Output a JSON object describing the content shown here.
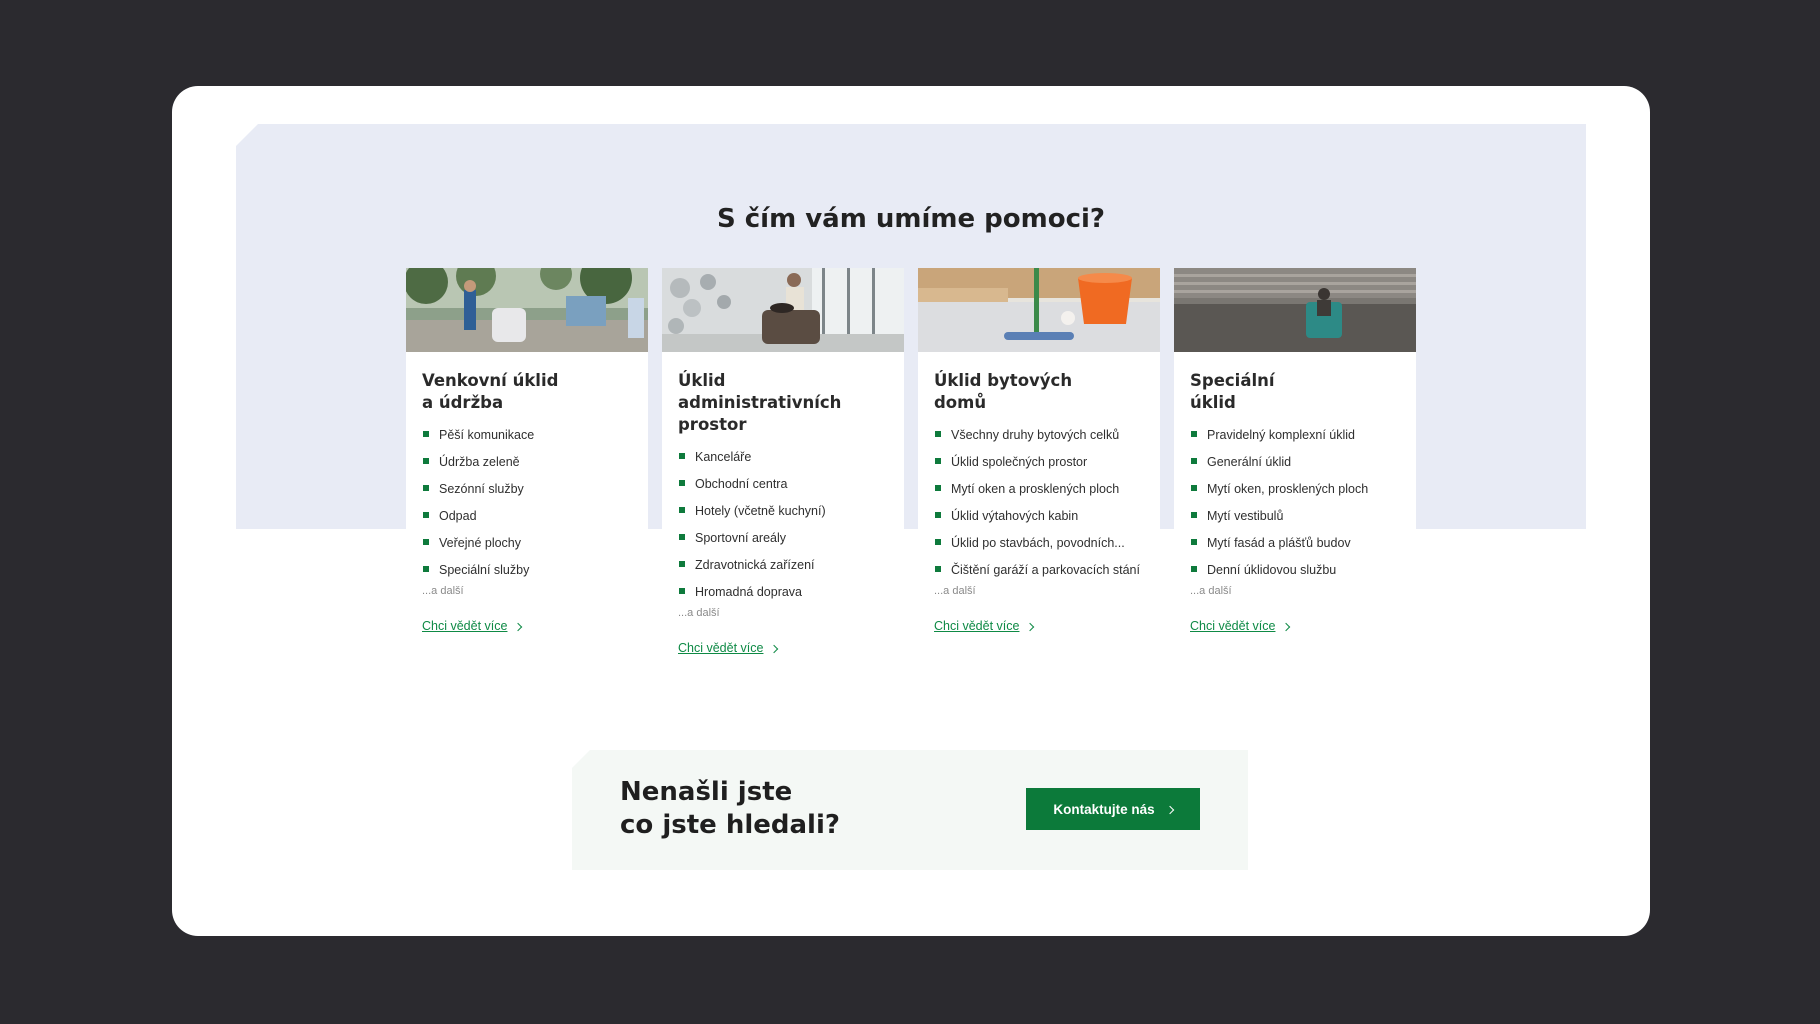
{
  "section": {
    "title": "S čím vám umíme pomoci?"
  },
  "cards": [
    {
      "title_line1": "Venkovní úklid",
      "title_line2": "a údržba",
      "items": [
        "Pěší komunikace",
        "Údržba zeleně",
        "Sezónní služby",
        "Odpad",
        "Veřejné plochy",
        "Speciální služby"
      ],
      "more": "...a další",
      "link": "Chci vědět více"
    },
    {
      "title_line1": "Úklid administrativních",
      "title_line2": "prostor",
      "items": [
        "Kanceláře",
        "Obchodní centra",
        "Hotely (včetně kuchyní)",
        "Sportovní areály",
        "Zdravotnická zařízení",
        "Hromadná doprava"
      ],
      "more": "...a další",
      "link": "Chci vědět více"
    },
    {
      "title_line1": "Úklid bytových",
      "title_line2": "domů",
      "items": [
        "Všechny druhy bytových celků",
        "Úklid společných prostor",
        "Mytí oken a prosklených ploch",
        "Úklid výtahových kabin",
        "Úklid po stavbách, povodních...",
        "Čištění garáží a parkovacích stání"
      ],
      "more": "...a další",
      "link": "Chci vědět více"
    },
    {
      "title_line1": "Speciální",
      "title_line2": "úklid",
      "items": [
        "Pravidelný komplexní úklid",
        "Generální úklid",
        "Mytí oken, prosklených ploch",
        "Mytí vestibulů",
        "Mytí fasád a plášťů budov",
        "Denní úklidovou službu"
      ],
      "more": "...a další",
      "link": "Chci vědět více"
    }
  ],
  "cta": {
    "line1": "Nenašli jste",
    "line2": "co jste hledali?",
    "button": "Kontaktujte nás"
  },
  "colors": {
    "accent": "#0c7a3a",
    "band": "#e8ebf5",
    "backdrop": "#2b2a2f"
  }
}
